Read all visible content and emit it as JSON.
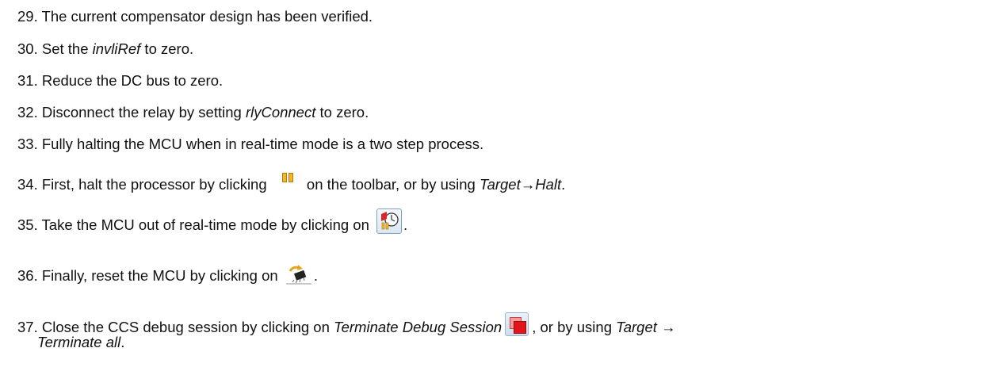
{
  "steps": [
    {
      "num": "29.",
      "t1": "The current compensator design has been verified."
    },
    {
      "num": "30.",
      "t1": "Set the ",
      "em1": "invliRef",
      "t2": " to zero."
    },
    {
      "num": "31.",
      "t1": "Reduce the DC bus to zero."
    },
    {
      "num": "32.",
      "t1": "Disconnect the relay by setting ",
      "em1": "rlyConnect",
      "t2": " to zero."
    },
    {
      "num": "33.",
      "t1": "Fully halting the MCU when in real-time mode is a two step process."
    },
    {
      "num": "34.",
      "t1": "First, halt the processor by clicking ",
      "t2": " on the toolbar, or by using ",
      "em1": "Target→Halt",
      "t3": "."
    },
    {
      "num": "35.",
      "t1": "Take the MCU out of real-time mode by clicking on ",
      "t2": "."
    },
    {
      "num": "36.",
      "t1": "Finally, reset the MCU by clicking on ",
      "t2": "."
    },
    {
      "num": "37.",
      "t1": "Close the CCS debug session by clicking on ",
      "em1": "Terminate Debug Session",
      "t2": ", or by using ",
      "em2": "Target →",
      "em3": "Terminate all",
      "t3": "."
    }
  ],
  "icons": {
    "halt": "pause-icon",
    "realtime": "realtime-mode-icon",
    "reset": "cpu-reset-icon",
    "terminate": "terminate-debug-session-icon"
  }
}
